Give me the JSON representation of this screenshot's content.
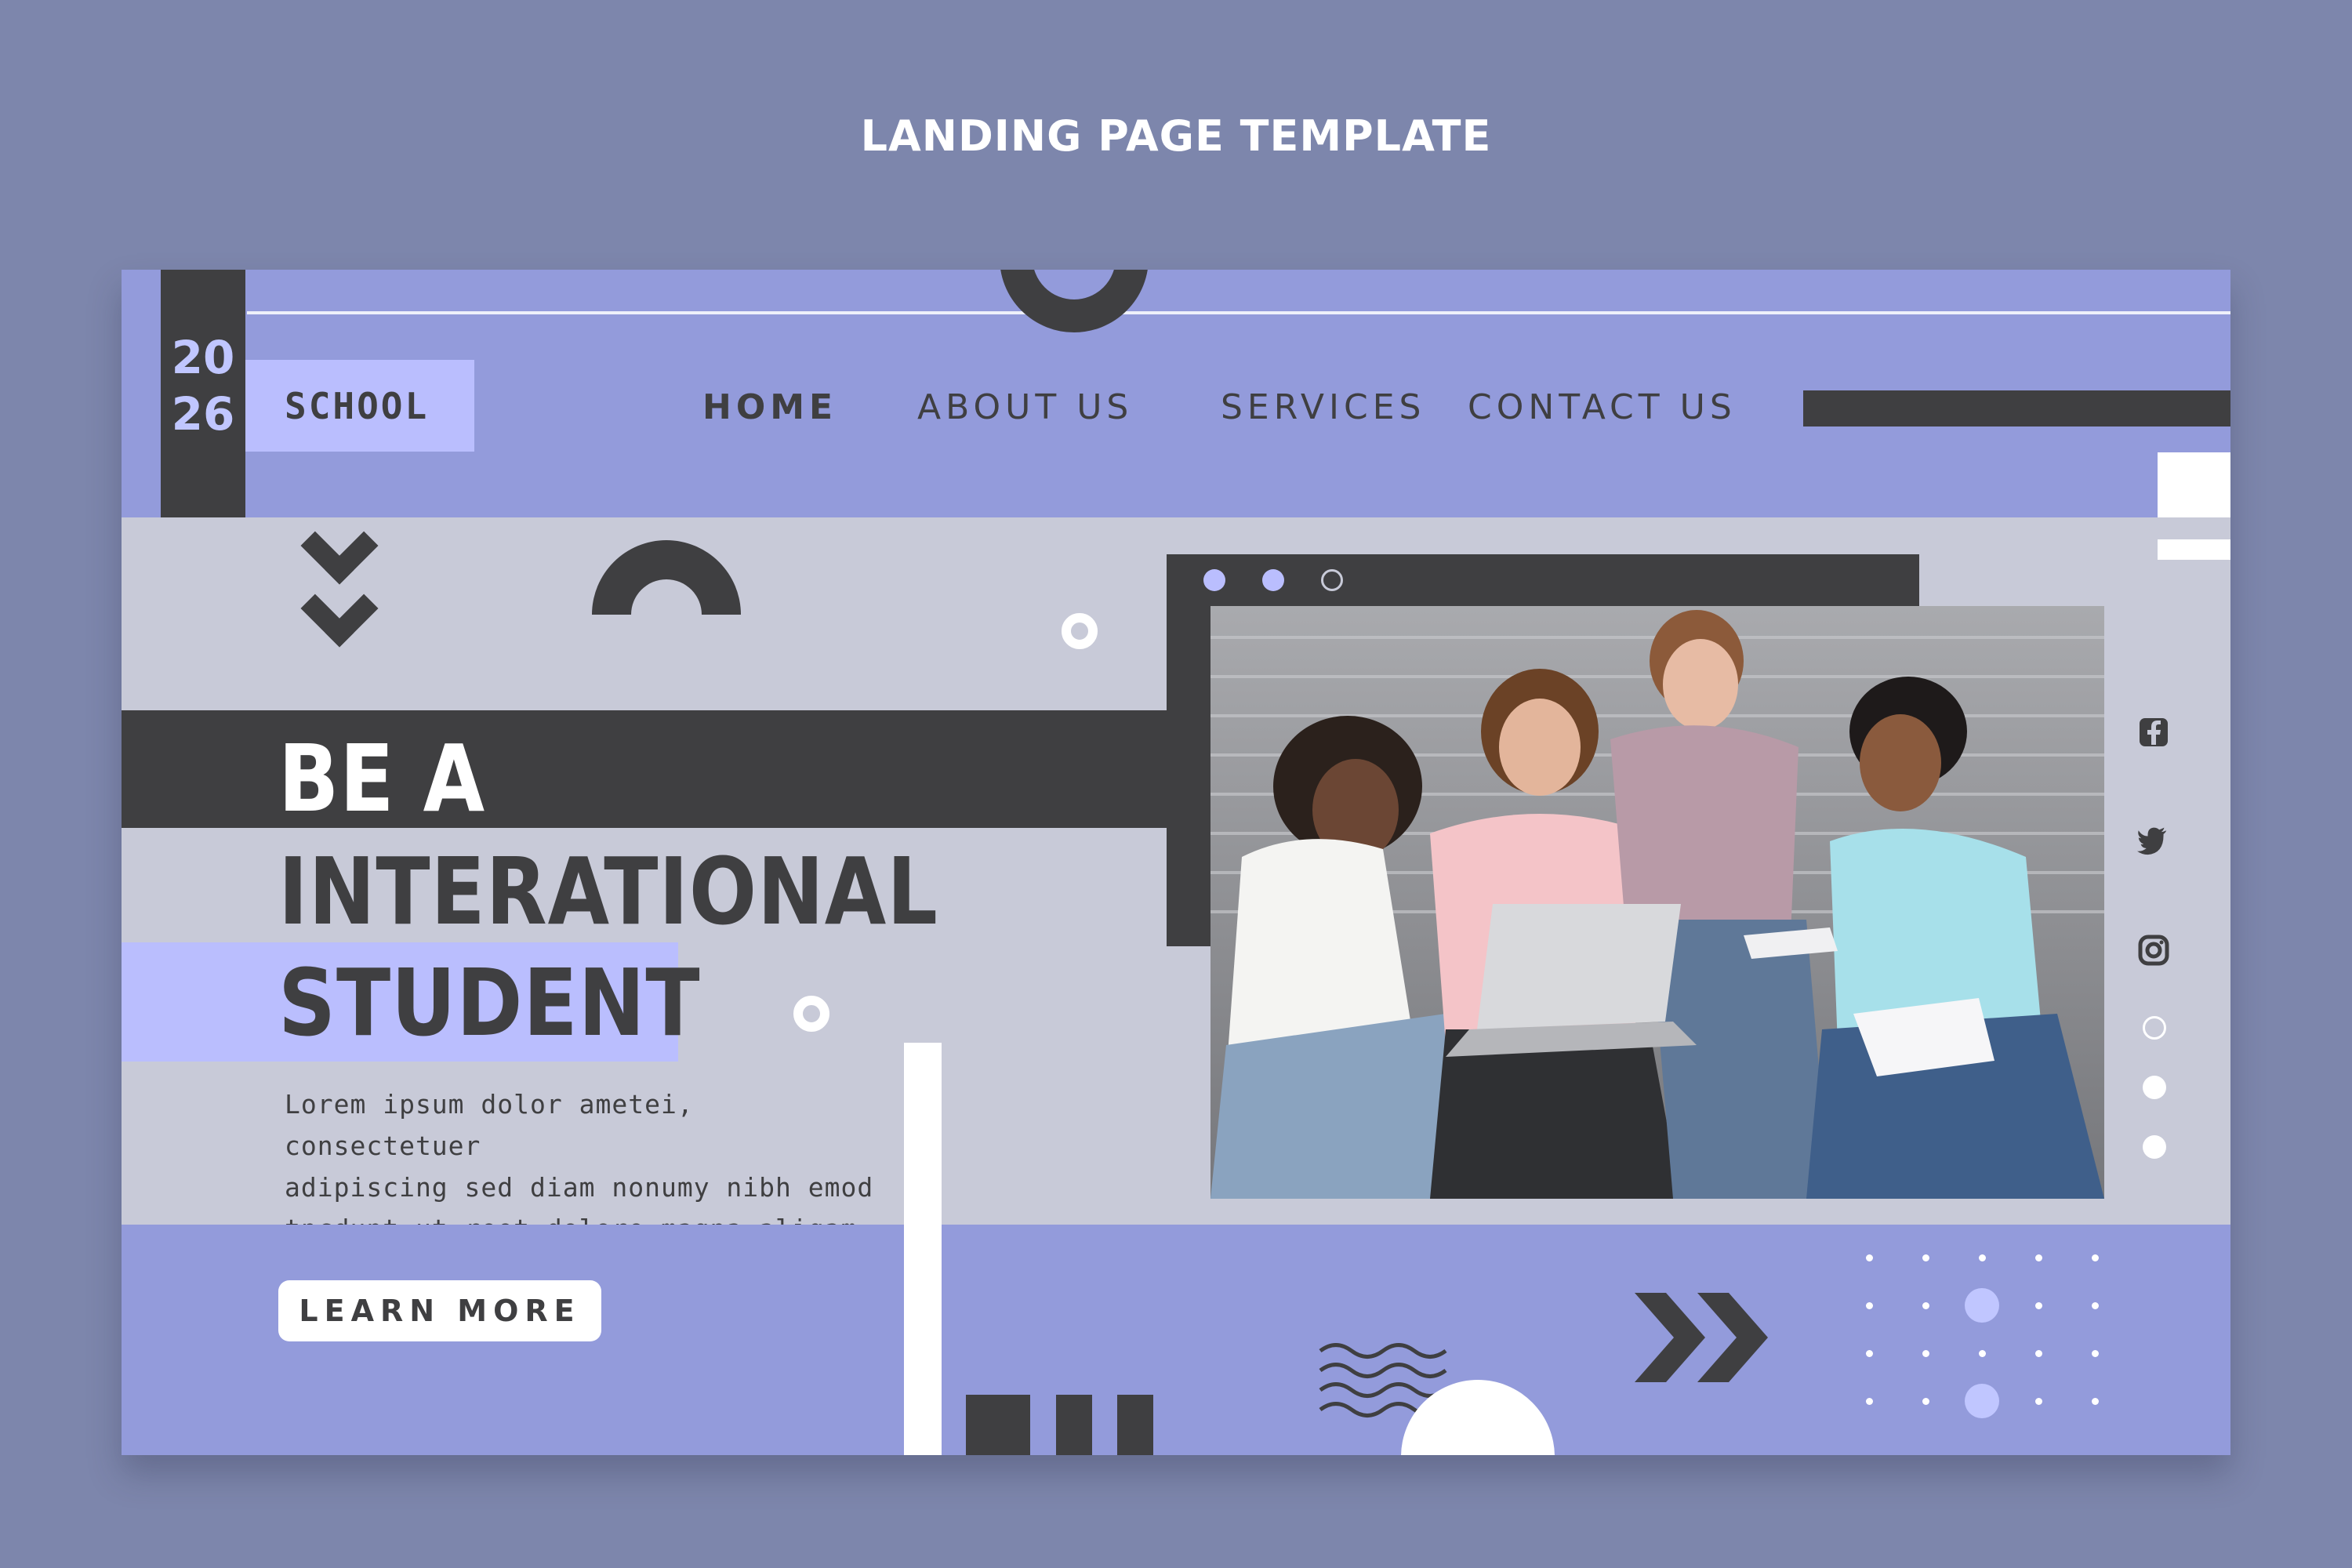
{
  "heading": "LANDING PAGE TEMPLATE",
  "brand": {
    "year_top": "20",
    "year_bottom": "26",
    "name": "SCHOOL"
  },
  "nav": {
    "items": [
      {
        "label": "HOME",
        "active": true
      },
      {
        "label": "ABOUT US",
        "active": false
      },
      {
        "label": "SERVICES",
        "active": false
      },
      {
        "label": "CONTACT US",
        "active": false
      }
    ]
  },
  "hero": {
    "line1": "BE A",
    "line2": "INTERATIONAL",
    "line3": "STUDENT",
    "description_lines": [
      "Lorem ipsum dolor ametei, consectetuer",
      "adipiscing  sed diam nonumy nibh emod",
      "tncdunt ut reet dolore magna aliqam et."
    ],
    "cta_label": "LEARN MORE"
  },
  "social": {
    "icons": [
      "facebook-icon",
      "twitter-icon",
      "instagram-icon"
    ]
  },
  "pagination": {
    "count": 3,
    "active_index": 0
  },
  "colors": {
    "background": "#7d86ac",
    "periwinkle": "#939bdb",
    "lavender": "#babefe",
    "grey_panel": "#c8cad8",
    "charcoal": "#3f3f41",
    "white": "#ffffff"
  }
}
